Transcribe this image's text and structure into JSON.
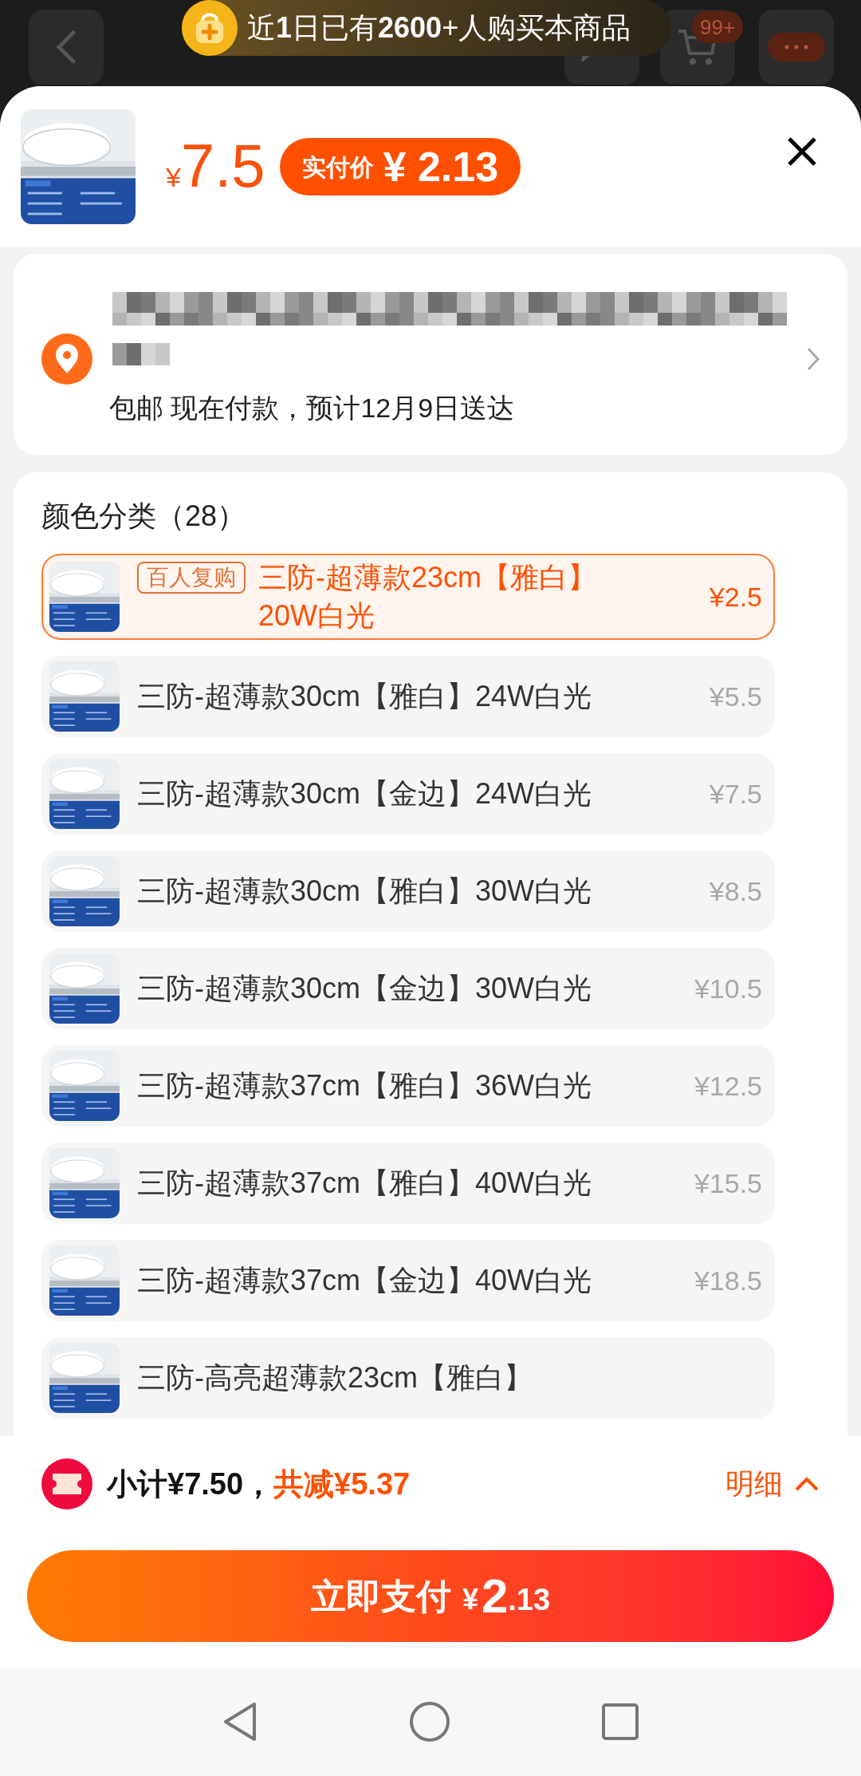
{
  "top_bar": {
    "banner": "近**1**日已有**2600**+人购买本商品",
    "cart_badge": "99+"
  },
  "header": {
    "price_currency": "¥",
    "price": "7.5",
    "final_price_label": "实付价",
    "final_price": "¥ 2.13"
  },
  "address": {
    "delivery": "包邮 现在付款，预计12月9日送达"
  },
  "variants": {
    "title": "颜色分类（28）",
    "items": [
      {
        "tag": "百人复购",
        "name": "三防-超薄款23cm【雅白】20W白光",
        "price": "¥2.5",
        "selected": true
      },
      {
        "name": "三防-超薄款30cm【雅白】24W白光",
        "price": "¥5.5",
        "selected": false
      },
      {
        "name": "三防-超薄款30cm【金边】24W白光",
        "price": "¥7.5",
        "selected": false
      },
      {
        "name": "三防-超薄款30cm【雅白】30W白光",
        "price": "¥8.5",
        "selected": false
      },
      {
        "name": "三防-超薄款30cm【金边】30W白光",
        "price": "¥10.5",
        "selected": false
      },
      {
        "name": "三防-超薄款37cm【雅白】36W白光",
        "price": "¥12.5",
        "selected": false
      },
      {
        "name": "三防-超薄款37cm【雅白】40W白光",
        "price": "¥15.5",
        "selected": false
      },
      {
        "name": "三防-超薄款37cm【金边】40W白光",
        "price": "¥18.5",
        "selected": false
      },
      {
        "name": "三防-高亮超薄款23cm【雅白】",
        "selected": false
      }
    ]
  },
  "summary": {
    "subtotal": "小计¥7.50，",
    "discount": "共减¥5.37",
    "details": "明细"
  },
  "pay_button": {
    "label": "立即支付",
    "currency": "¥",
    "integer": "2",
    "decimal": ".13"
  }
}
